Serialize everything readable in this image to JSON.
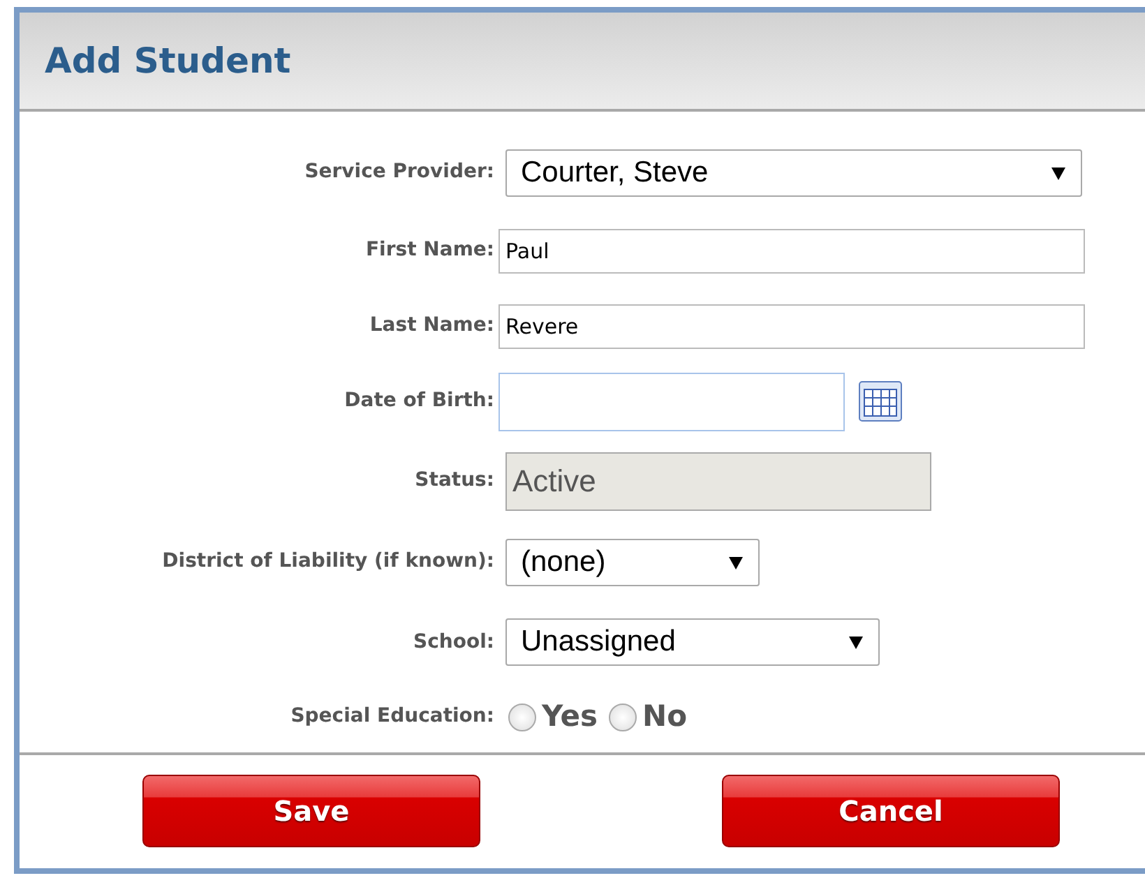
{
  "dialog": {
    "title": "Add Student"
  },
  "fields": [
    {
      "kind": "select",
      "label": "Service Provider:",
      "value": "Courter, Steve"
    },
    {
      "kind": "text",
      "label": "First Name:",
      "value": "Paul"
    },
    {
      "kind": "text",
      "label": "Last Name:",
      "value": "Revere"
    },
    {
      "kind": "date",
      "label": "Date of Birth:"
    },
    {
      "kind": "readonly",
      "label": "Status:",
      "value": "Active",
      "disabled": true
    },
    {
      "kind": "select",
      "label": "District of Liability (if known):",
      "value": "(none)"
    },
    {
      "kind": "select",
      "label": "School:",
      "value": "Unassigned"
    },
    {
      "kind": "radio",
      "label": "Special Education:",
      "options": [
        {
          "label": "Yes",
          "selected": false
        },
        {
          "label": "No",
          "selected": false
        }
      ]
    }
  ],
  "buttons": [
    {
      "label": "Save"
    },
    {
      "label": "Cancel"
    }
  ]
}
